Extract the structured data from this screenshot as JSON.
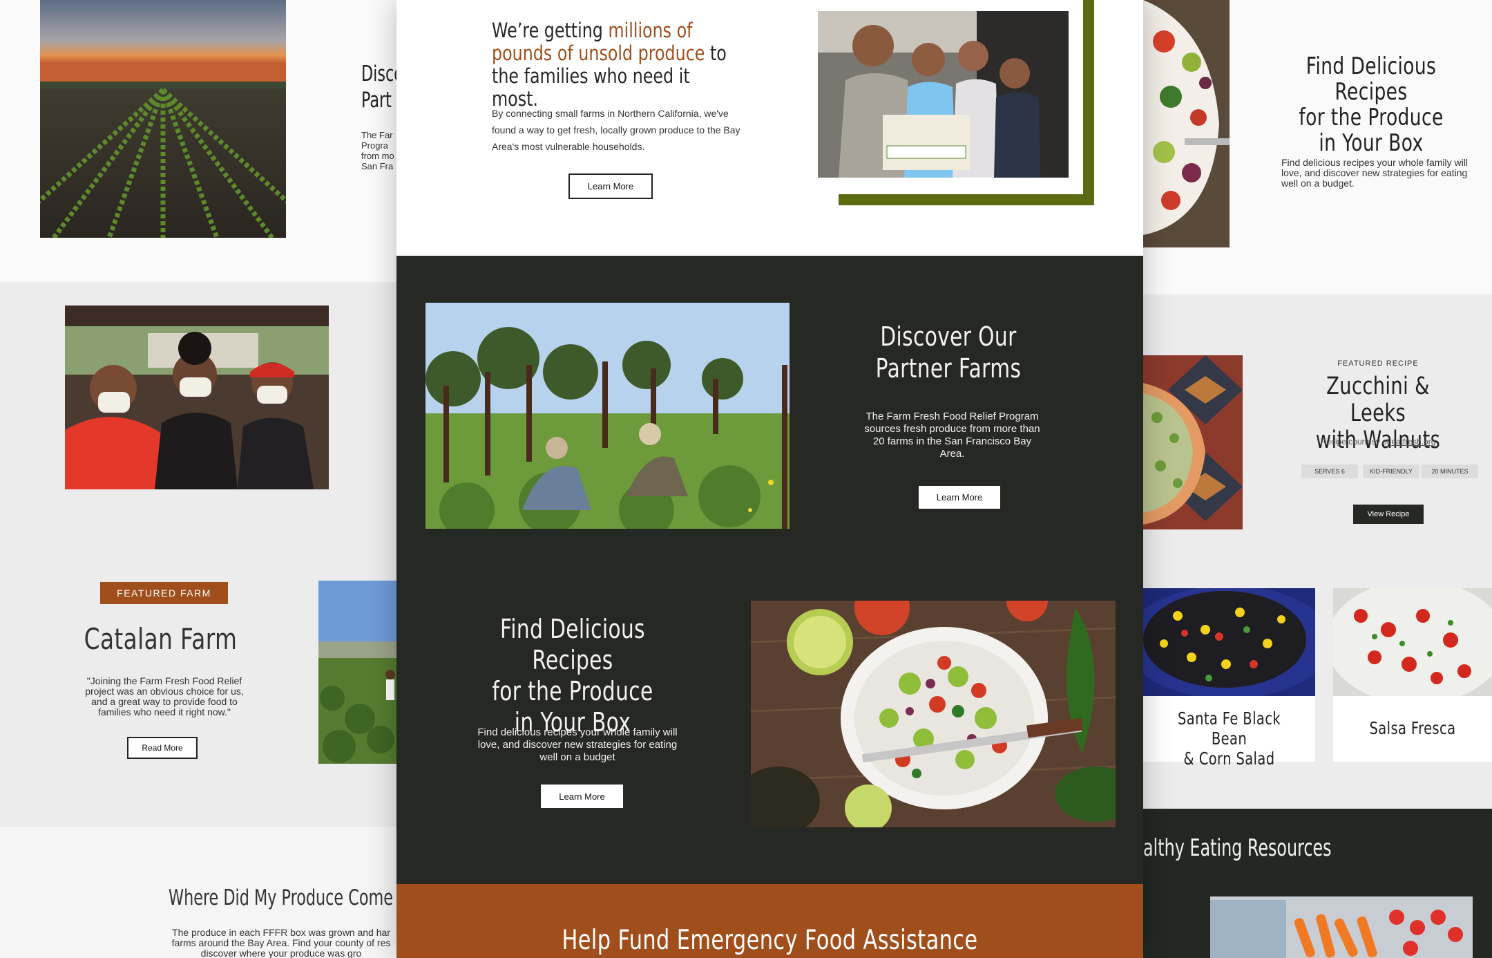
{
  "colors": {
    "rust": "#a04e1c",
    "dark": "#262824",
    "olive": "#5a6b12",
    "light_bg": "#ececec",
    "pale_bg": "#f5f5f5"
  },
  "left_column": {
    "discover_partial_heading_1": "Disco",
    "discover_partial_heading_2": "Part",
    "discover_partial_body": [
      "The Far",
      "Progra",
      "from mo",
      "San Fra"
    ],
    "featured_farm_badge": "FEATURED FARM",
    "featured_farm_name": "Catalan Farm",
    "featured_farm_quote": "\"Joining the Farm Fresh Food Relief project was an obvious choice for us, and a great way to provide food to families who need it right now.\"",
    "read_more_label": "Read More",
    "where_heading": "Where Did My Produce Come",
    "where_body": "The produce in each FFFR box was grown and har farms around the Bay Area. Find your county of res discover where your produce was gro"
  },
  "center_column": {
    "hero": {
      "heading_pre": "We’re getting ",
      "heading_highlight": "millions of pounds of unsold produce",
      "heading_post": " to the families who need it most.",
      "body": "By connecting small farms in Northern California, we've found a way to get fresh, locally grown produce to the Bay Area's most vulnerable households.",
      "button_label": "Learn More"
    },
    "partner_farms": {
      "heading_line1": "Discover Our",
      "heading_line2": "Partner Farms",
      "body": "The Farm Fresh Food Relief Program sources fresh produce from more than 20 farms in the San Francisco Bay Area.",
      "button_label": "Learn More"
    },
    "recipes": {
      "heading_line1": "Find Delicious Recipes",
      "heading_line2": "for the Produce",
      "heading_line3": "in Your Box",
      "body": "Find delicious recipes your whole family will love, and discover new strategies for eating well on a budget",
      "button_label": "Learn More"
    },
    "fund_banner": "Help Fund Emergency Food Assistance"
  },
  "right_column": {
    "recipes_heading_line1": "Find Delicious Recipes",
    "recipes_heading_line2": "for the Produce",
    "recipes_heading_line3": "in Your Box",
    "recipes_body": "Find delicious recipes your whole family will love, and discover new strategies for eating well on a budget.",
    "featured_recipe_label": "FEATURED RECIPE",
    "featured_recipe_title_line1": "Zucchini & Leeks",
    "featured_recipe_title_line2": "with Walnuts",
    "recipe_courtesy_prefix": "Recipe courtesy of ",
    "recipe_courtesy_link": "eatfresh.org",
    "tags": [
      "SERVES 6",
      "KID-FRIENDLY",
      "20 MINUTES"
    ],
    "view_recipe_label": "View Recipe",
    "card_1_line1": "Santa Fe Black Bean",
    "card_1_line2": "& Corn Salad",
    "card_2": "Salsa Fresca",
    "resources_heading": "althy Eating Resources"
  }
}
